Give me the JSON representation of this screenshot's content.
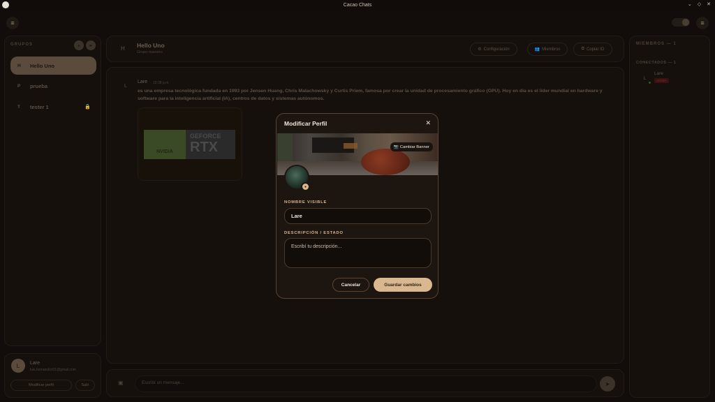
{
  "window": {
    "title": "Cacao Chats",
    "controls": [
      "⌄",
      "◇",
      "✕"
    ]
  },
  "sidebar": {
    "header": "GRUPOS",
    "groups": [
      {
        "initial": "H",
        "name": "Hello Uno",
        "active": true
      },
      {
        "initial": "P",
        "name": "prueba"
      },
      {
        "initial": "T",
        "name": "tester 1",
        "locked": true
      }
    ]
  },
  "user_panel": {
    "initial": "L",
    "name": "Lare",
    "email": "luis.hernandez01@gmail.com",
    "edit_profile_label": "Modificar perfil",
    "logout_label": "Salir"
  },
  "channel_header": {
    "initial": "H",
    "title": "Hello Uno",
    "subtitle": "Grupo maestro",
    "settings_label": "Configuración",
    "members_label": "Miembros",
    "copy_id_label": "Copiar ID"
  },
  "message": {
    "author_initial": "L",
    "author": "Lare",
    "time": "10:38 p.m.",
    "text": "es una empresa tecnológica fundada en 1993 por Jensen Huang, Chris Malachowsky y Curtis Priem, famosa por crear la unidad de procesamiento gráfico (GPU). Hoy en día es el líder mundial en hardware y software para la inteligencia artificial (IA), centros de datos y sistemas autónomos.",
    "image": {
      "brand": "NVIDIA",
      "line1": "GEFORCE",
      "line2": "RTX"
    }
  },
  "composer": {
    "placeholder": "Escribí un mensaje..."
  },
  "members_panel": {
    "header": "MIEMBROS — 1",
    "online_header": "CONECTADOS — 1",
    "members": [
      {
        "initial": "L",
        "name": "Lare",
        "role": "ADMIN"
      }
    ]
  },
  "modal": {
    "title": "Modificar Perfil",
    "change_banner_label": "Cambiar Banner",
    "display_name_label": "NOMBRE VISIBLE",
    "display_name_value": "Lare",
    "description_label": "DESCRIPCIÓN / ESTADO",
    "description_placeholder": "Escribí tu descripción...",
    "cancel_label": "Cancelar",
    "save_label": "Guardar cambios"
  },
  "colors": {
    "accent": "#d9b890",
    "background": "#120d0a",
    "modal_border": "#5a4434"
  }
}
